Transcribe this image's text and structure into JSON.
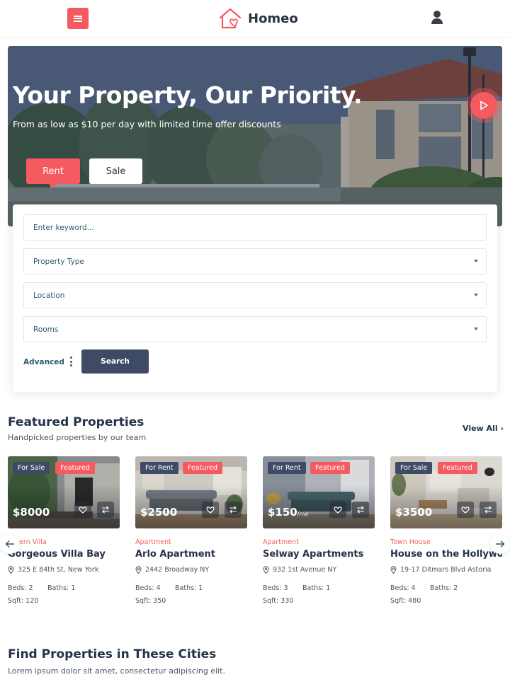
{
  "header": {
    "brand": "Homeo",
    "menu_icon": "hamburger-icon",
    "user_icon": "user-icon"
  },
  "hero": {
    "title": "Your Property, Our Priority.",
    "subtitle": "From as low as $10 per day with limited time offer discounts",
    "tabs": [
      {
        "label": "Rent",
        "active": true
      },
      {
        "label": "Sale",
        "active": false
      }
    ],
    "play_icon": "play-icon"
  },
  "search": {
    "keyword_placeholder": "Enter keyword...",
    "property_type": "Property Type",
    "location": "Location",
    "rooms": "Rooms",
    "advanced": "Advanced",
    "search_button": "Search"
  },
  "featured": {
    "title": "Featured Properties",
    "subtitle": "Handpicked properties by our team",
    "view_all": "View All",
    "cards": [
      {
        "status": "For Sale",
        "featured": "Featured",
        "price": "$8000",
        "price_suffix": "",
        "category": "Modern Villa",
        "category_visible": "dern Villa",
        "name": "Gorgeous Villa Bay",
        "address": "325 E 84th St, New York",
        "beds": "Beds: 2",
        "baths": "Baths: 1",
        "sqft": "Sqft: 120"
      },
      {
        "status": "For Rent",
        "featured": "Featured",
        "price": "$2500",
        "price_suffix": "",
        "category": "Apartment",
        "name": "Arlo Apartment",
        "address": "2442 Broadway NY",
        "beds": "Beds: 4",
        "baths": "Baths: 1",
        "sqft": "Sqft: 350"
      },
      {
        "status": "For Rent",
        "featured": "Featured",
        "price": "$150",
        "price_suffix": "/mo",
        "category": "Apartment",
        "name": "Selway Apartments",
        "address": "932 1st Avenue NY",
        "beds": "Beds: 3",
        "baths": "Baths: 1",
        "sqft": "Sqft: 330"
      },
      {
        "status": "For Sale",
        "featured": "Featured",
        "price": "$3500",
        "price_suffix": "",
        "category": "Town House",
        "name": "House on the Hollywood",
        "address": "19-17 Ditmars Blvd Astoria",
        "beds": "Beds: 4",
        "baths": "Baths: 2",
        "sqft": "Sqft: 480"
      }
    ]
  },
  "cities": {
    "title": "Find Properties in These Cities",
    "subtitle": "Lorem ipsum dolor sit amet, consectetur adipiscing elit."
  },
  "colors": {
    "accent": "#f55a61",
    "dark": "#3e4a66",
    "text": "#24324a"
  }
}
